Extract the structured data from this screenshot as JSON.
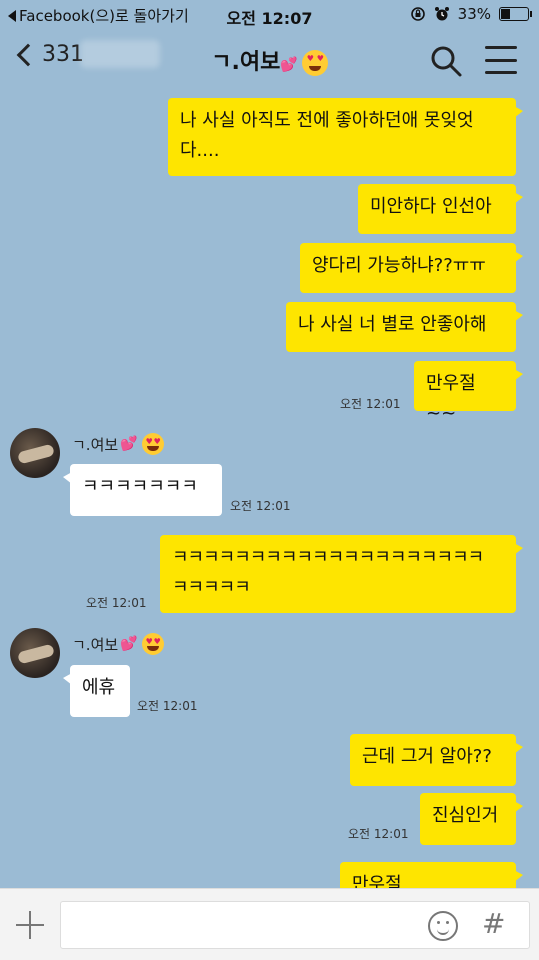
{
  "status_bar": {
    "back_app": "Facebook(으)로 돌아가기",
    "time": "오전 12:07",
    "battery_percent": "33%",
    "battery_level": 0.33
  },
  "header": {
    "unread_count": "331",
    "chat_name": "ㄱ.여보"
  },
  "messages": [
    {
      "from": "me",
      "text": "나 사실 아직도 전에 좋아하던애 못잊엇다...."
    },
    {
      "from": "me",
      "text": "미안하다 인선아"
    },
    {
      "from": "me",
      "text": "양다리 가능하냐??ㅠㅠ"
    },
    {
      "from": "me",
      "text": "나 사실 너 별로 안좋아해"
    },
    {
      "from": "me",
      "text": "만우절~~",
      "time": "오전 12:01"
    },
    {
      "from": "other",
      "sender": "ㄱ.여보",
      "text": "ㅋㅋㅋㅋㅋㅋㅋ",
      "time": "오전 12:01"
    },
    {
      "from": "me",
      "text_line1": "ㅋㅋㅋㅋㅋㅋㅋㅋㅋㅋㅋㅋㅋㅋㅋㅋㅋㅋㅋㅋ",
      "text_line2": "ㅋㅋㅋㅋㅋ",
      "time": "오전 12:01"
    },
    {
      "from": "other",
      "sender": "ㄱ.여보",
      "text": "에휴",
      "time": "오전 12:01"
    },
    {
      "from": "me",
      "text": "근데 그거 알아??"
    },
    {
      "from": "me",
      "text": "진심인거",
      "time": "오전 12:01"
    },
    {
      "from": "me",
      "text": "만우절~~~~~~~~"
    }
  ],
  "input_bar": {
    "placeholder": "",
    "hash_symbol": "#"
  }
}
